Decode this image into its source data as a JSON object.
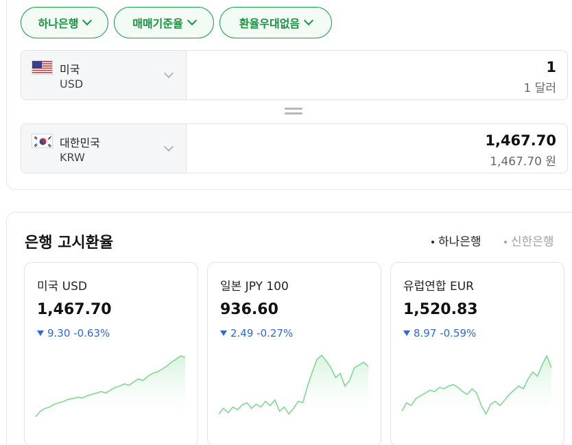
{
  "filters": [
    {
      "label": "하나은행"
    },
    {
      "label": "매매기준율"
    },
    {
      "label": "환율우대없음"
    }
  ],
  "converter": {
    "from": {
      "country": "미국",
      "code": "USD",
      "amount": "1",
      "amount_text": "1 달러",
      "flag": "us-flag-icon"
    },
    "to": {
      "country": "대한민국",
      "code": "KRW",
      "amount": "1,467.70",
      "amount_text": "1,467.70 원",
      "flag": "kr-flag-icon"
    }
  },
  "rates_section": {
    "title": "은행 고시환율",
    "tabs": [
      {
        "label": "하나은행",
        "active": true
      },
      {
        "label": "신한은행",
        "active": false
      }
    ],
    "cards": [
      {
        "title": "미국 USD",
        "value": "1,467.70",
        "change": "9.30",
        "percent": "-0.63%",
        "direction": "down",
        "trend": [
          0.08,
          0.16,
          0.2,
          0.22,
          0.26,
          0.28,
          0.3,
          0.33,
          0.34,
          0.36,
          0.35,
          0.38,
          0.4,
          0.42,
          0.44,
          0.42,
          0.46,
          0.5,
          0.52,
          0.55,
          0.53,
          0.58,
          0.62,
          0.6,
          0.66,
          0.7,
          0.72,
          0.76,
          0.8,
          0.86,
          0.9,
          0.95,
          0.93
        ]
      },
      {
        "title": "일본 JPY 100",
        "value": "936.60",
        "change": "2.49",
        "percent": "-0.27%",
        "direction": "down",
        "trend": [
          0.12,
          0.2,
          0.14,
          0.22,
          0.18,
          0.25,
          0.28,
          0.2,
          0.26,
          0.22,
          0.3,
          0.24,
          0.32,
          0.16,
          0.22,
          0.12,
          0.2,
          0.3,
          0.28,
          0.52,
          0.72,
          0.9,
          0.96,
          0.88,
          0.78,
          0.64,
          0.7,
          0.52,
          0.6,
          0.78,
          0.82,
          0.86,
          0.8
        ]
      },
      {
        "title": "유럽연합 EUR",
        "value": "1,520.83",
        "change": "8.97",
        "percent": "-0.59%",
        "direction": "down",
        "trend": [
          0.16,
          0.28,
          0.24,
          0.34,
          0.38,
          0.42,
          0.46,
          0.44,
          0.5,
          0.48,
          0.52,
          0.54,
          0.5,
          0.44,
          0.4,
          0.48,
          0.42,
          0.24,
          0.12,
          0.26,
          0.3,
          0.24,
          0.32,
          0.4,
          0.46,
          0.52,
          0.48,
          0.62,
          0.72,
          0.66,
          0.82,
          0.95,
          0.78
        ]
      }
    ]
  },
  "colors": {
    "accent": "#17933f",
    "down": "#2e67d8",
    "chart_line": "#7fd88f",
    "chart_fill": "#d6f3dc"
  }
}
